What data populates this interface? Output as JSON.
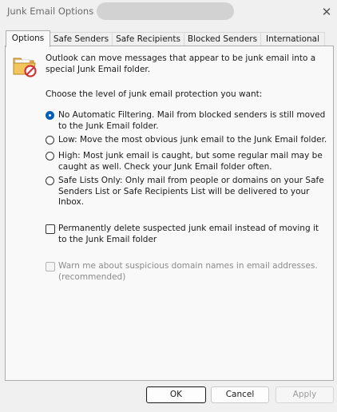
{
  "window": {
    "title": "Junk Email Options"
  },
  "tabs": [
    {
      "label": "Options"
    },
    {
      "label": "Safe Senders"
    },
    {
      "label": "Safe Recipients"
    },
    {
      "label": "Blocked Senders"
    },
    {
      "label": "International"
    }
  ],
  "options": {
    "description": "Outlook can move messages that appear to be junk email into a special Junk Email folder.",
    "choose_label": "Choose the level of junk email protection you want:",
    "levels": [
      {
        "label": "No Automatic Filtering. Mail from blocked senders is still moved to the Junk Email folder.",
        "selected": true
      },
      {
        "label": "Low: Move the most obvious junk email to the Junk Email folder.",
        "selected": false
      },
      {
        "label": "High: Most junk email is caught, but some regular mail may be caught as well. Check your Junk Email folder often.",
        "selected": false
      },
      {
        "label": "Safe Lists Only: Only mail from people or domains on your Safe Senders List or Safe Recipients List will be delivered to your Inbox.",
        "selected": false
      }
    ],
    "permanently_delete": {
      "label": "Permanently delete suspected junk email instead of moving it to the Junk Email folder",
      "checked": false
    },
    "warn_suspicious": {
      "label": "Warn me about suspicious domain names in email addresses. (recommended)",
      "checked": false,
      "enabled": false
    }
  },
  "buttons": {
    "ok": "OK",
    "cancel": "Cancel",
    "apply": "Apply"
  },
  "icons": {
    "close": "close-icon",
    "junk": "junk-folder-icon"
  },
  "colors": {
    "accent": "#005fb8",
    "blocked_red": "#d13438"
  }
}
